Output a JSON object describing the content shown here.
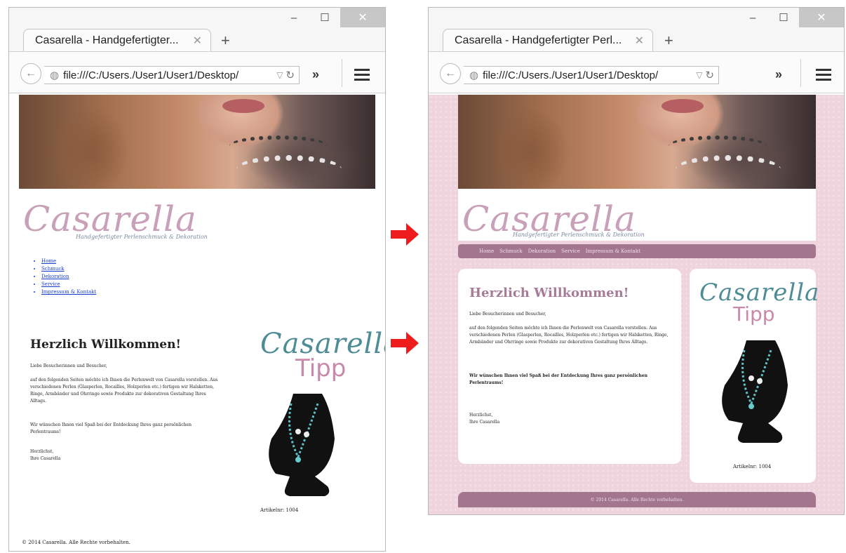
{
  "browser": {
    "tab_title_left": "Casarella - Handgefertigter...",
    "tab_title_right": "Casarella - Handgefertigter Perl...",
    "url": "file:///C:/Users./User1/User1/Desktop/",
    "minimize": "–",
    "maximize": "☐",
    "close": "✕",
    "new_tab": "+",
    "overflow": "»"
  },
  "site": {
    "logo": "Casarella",
    "tagline": "Handgefertigter Perlenschmuck & Dekoration",
    "nav": [
      "Home",
      "Schmuck",
      "Dekoration",
      "Service",
      "Impressum & Kontakt"
    ],
    "heading": "Herzlich Willkommen!",
    "greeting": "Liebe Besucherinnen und Besucher,",
    "intro": "auf den folgenden Seiten möchte ich Ihnen die Perlenwelt von Casarella vorstellen. Aus verschiedenen Perlen (Glasperlen, Rocailles, Holzperlen etc.) fertigen wir Halsketten, Ringe, Armbänder und Ohrringe sowie Produkte zur dekorativen Gestaltung Ihres Alltags.",
    "wish": "Wir wünschen Ihnen viel Spaß bei der Entdeckung Ihres ganz persönlichen Perlentraums!",
    "signoff1": "Herzlichst,",
    "signoff2": "Ihre Casarella",
    "tipp_script": "Casarella",
    "tipp_word": "Tipp",
    "article": "Artikelnr: 1004",
    "footer": "© 2014 Casarella. Alle Rechte vorbehalten."
  },
  "colors": {
    "page_pink": "#efd3dd",
    "mauve": "#a3758f",
    "heading_mauve": "#a77b97",
    "arrow_red": "#ee1c1c",
    "teal": "#4f8c96"
  }
}
